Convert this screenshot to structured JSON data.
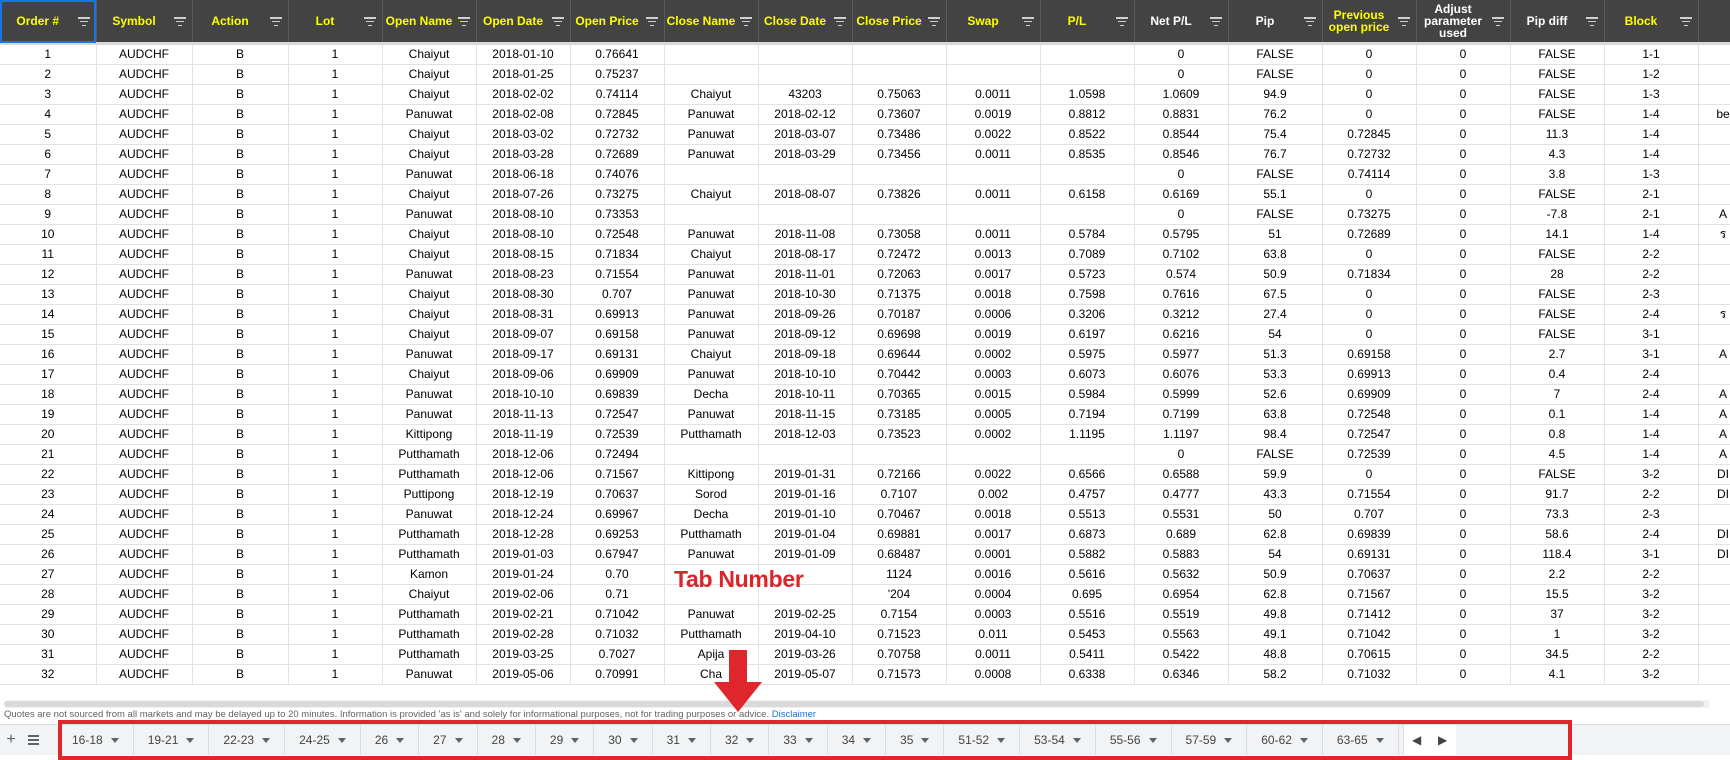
{
  "columns": [
    {
      "label": "Order #",
      "color": "yellow"
    },
    {
      "label": "Symbol",
      "color": "yellow"
    },
    {
      "label": "Action",
      "color": "yellow"
    },
    {
      "label": "Lot",
      "color": "yellow"
    },
    {
      "label": "Open Name",
      "color": "yellow"
    },
    {
      "label": "Open Date",
      "color": "yellow"
    },
    {
      "label": "Open Price",
      "color": "yellow"
    },
    {
      "label": "Close Name",
      "color": "yellow"
    },
    {
      "label": "Close Date",
      "color": "yellow"
    },
    {
      "label": "Close Price",
      "color": "yellow"
    },
    {
      "label": "Swap",
      "color": "yellow"
    },
    {
      "label": "P/L",
      "color": "yellow"
    },
    {
      "label": "Net P/L",
      "color": "white"
    },
    {
      "label": "Pip",
      "color": "white"
    },
    {
      "label": "Previous open price",
      "color": "yellow"
    },
    {
      "label": "Adjust parameter used",
      "color": "white"
    },
    {
      "label": "Pip diff",
      "color": "white"
    },
    {
      "label": "Block",
      "color": "yellow"
    },
    {
      "label": "",
      "color": "white"
    }
  ],
  "rows": [
    [
      "1",
      "AUDCHF",
      "B",
      "1",
      "Chaiyut",
      "2018-01-10",
      "0.76641",
      "",
      "",
      "",
      "",
      "",
      "0",
      "FALSE",
      "0",
      "0",
      "FALSE",
      "1-1",
      ""
    ],
    [
      "2",
      "AUDCHF",
      "B",
      "1",
      "Chaiyut",
      "2018-01-25",
      "0.75237",
      "",
      "",
      "",
      "",
      "",
      "0",
      "FALSE",
      "0",
      "0",
      "FALSE",
      "1-2",
      ""
    ],
    [
      "3",
      "AUDCHF",
      "B",
      "1",
      "Chaiyut",
      "2018-02-02",
      "0.74114",
      "Chaiyut",
      "43203",
      "0.75063",
      "0.0011",
      "1.0598",
      "1.0609",
      "94.9",
      "0",
      "0",
      "FALSE",
      "1-3",
      ""
    ],
    [
      "4",
      "AUDCHF",
      "B",
      "1",
      "Panuwat",
      "2018-02-08",
      "0.72845",
      "Panuwat",
      "2018-02-12",
      "0.73607",
      "0.0019",
      "0.8812",
      "0.8831",
      "76.2",
      "0",
      "0",
      "FALSE",
      "1-4",
      "be"
    ],
    [
      "5",
      "AUDCHF",
      "B",
      "1",
      "Chaiyut",
      "2018-03-02",
      "0.72732",
      "Panuwat",
      "2018-03-07",
      "0.73486",
      "0.0022",
      "0.8522",
      "0.8544",
      "75.4",
      "0.72845",
      "0",
      "11.3",
      "1-4",
      ""
    ],
    [
      "6",
      "AUDCHF",
      "B",
      "1",
      "Chaiyut",
      "2018-03-28",
      "0.72689",
      "Panuwat",
      "2018-03-29",
      "0.73456",
      "0.0011",
      "0.8535",
      "0.8546",
      "76.7",
      "0.72732",
      "0",
      "4.3",
      "1-4",
      ""
    ],
    [
      "7",
      "AUDCHF",
      "B",
      "1",
      "Panuwat",
      "2018-06-18",
      "0.74076",
      "",
      "",
      "",
      "",
      "",
      "0",
      "FALSE",
      "0.74114",
      "0",
      "3.8",
      "1-3",
      ""
    ],
    [
      "8",
      "AUDCHF",
      "B",
      "1",
      "Chaiyut",
      "2018-07-26",
      "0.73275",
      "Chaiyut",
      "2018-08-07",
      "0.73826",
      "0.0011",
      "0.6158",
      "0.6169",
      "55.1",
      "0",
      "0",
      "FALSE",
      "2-1",
      ""
    ],
    [
      "9",
      "AUDCHF",
      "B",
      "1",
      "Panuwat",
      "2018-08-10",
      "0.73353",
      "",
      "",
      "",
      "",
      "",
      "0",
      "FALSE",
      "0.73275",
      "0",
      "-7.8",
      "2-1",
      "A"
    ],
    [
      "10",
      "AUDCHF",
      "B",
      "1",
      "Chaiyut",
      "2018-08-10",
      "0.72548",
      "Panuwat",
      "2018-11-08",
      "0.73058",
      "0.0011",
      "0.5784",
      "0.5795",
      "51",
      "0.72689",
      "0",
      "14.1",
      "1-4",
      "ร"
    ],
    [
      "11",
      "AUDCHF",
      "B",
      "1",
      "Chaiyut",
      "2018-08-15",
      "0.71834",
      "Chaiyut",
      "2018-08-17",
      "0.72472",
      "0.0013",
      "0.7089",
      "0.7102",
      "63.8",
      "0",
      "0",
      "FALSE",
      "2-2",
      ""
    ],
    [
      "12",
      "AUDCHF",
      "B",
      "1",
      "Panuwat",
      "2018-08-23",
      "0.71554",
      "Panuwat",
      "2018-11-01",
      "0.72063",
      "0.0017",
      "0.5723",
      "0.574",
      "50.9",
      "0.71834",
      "0",
      "28",
      "2-2",
      ""
    ],
    [
      "13",
      "AUDCHF",
      "B",
      "1",
      "Chaiyut",
      "2018-08-30",
      "0.707",
      "Panuwat",
      "2018-10-30",
      "0.71375",
      "0.0018",
      "0.7598",
      "0.7616",
      "67.5",
      "0",
      "0",
      "FALSE",
      "2-3",
      ""
    ],
    [
      "14",
      "AUDCHF",
      "B",
      "1",
      "Chaiyut",
      "2018-08-31",
      "0.69913",
      "Panuwat",
      "2018-09-26",
      "0.70187",
      "0.0006",
      "0.3206",
      "0.3212",
      "27.4",
      "0",
      "0",
      "FALSE",
      "2-4",
      "ร"
    ],
    [
      "15",
      "AUDCHF",
      "B",
      "1",
      "Chaiyut",
      "2018-09-07",
      "0.69158",
      "Panuwat",
      "2018-09-12",
      "0.69698",
      "0.0019",
      "0.6197",
      "0.6216",
      "54",
      "0",
      "0",
      "FALSE",
      "3-1",
      ""
    ],
    [
      "16",
      "AUDCHF",
      "B",
      "1",
      "Panuwat",
      "2018-09-17",
      "0.69131",
      "Chaiyut",
      "2018-09-18",
      "0.69644",
      "0.0002",
      "0.5975",
      "0.5977",
      "51.3",
      "0.69158",
      "0",
      "2.7",
      "3-1",
      "A"
    ],
    [
      "17",
      "AUDCHF",
      "B",
      "1",
      "Chaiyut",
      "2018-09-06",
      "0.69909",
      "Panuwat",
      "2018-10-10",
      "0.70442",
      "0.0003",
      "0.6073",
      "0.6076",
      "53.3",
      "0.69913",
      "0",
      "0.4",
      "2-4",
      ""
    ],
    [
      "18",
      "AUDCHF",
      "B",
      "1",
      "Panuwat",
      "2018-10-10",
      "0.69839",
      "Decha",
      "2018-10-11",
      "0.70365",
      "0.0015",
      "0.5984",
      "0.5999",
      "52.6",
      "0.69909",
      "0",
      "7",
      "2-4",
      "A"
    ],
    [
      "19",
      "AUDCHF",
      "B",
      "1",
      "Panuwat",
      "2018-11-13",
      "0.72547",
      "Panuwat",
      "2018-11-15",
      "0.73185",
      "0.0005",
      "0.7194",
      "0.7199",
      "63.8",
      "0.72548",
      "0",
      "0.1",
      "1-4",
      "A"
    ],
    [
      "20",
      "AUDCHF",
      "B",
      "1",
      "Kittipong",
      "2018-11-19",
      "0.72539",
      "Putthamath",
      "2018-12-03",
      "0.73523",
      "0.0002",
      "1.1195",
      "1.1197",
      "98.4",
      "0.72547",
      "0",
      "0.8",
      "1-4",
      "A"
    ],
    [
      "21",
      "AUDCHF",
      "B",
      "1",
      "Putthamath",
      "2018-12-06",
      "0.72494",
      "",
      "",
      "",
      "",
      "",
      "0",
      "FALSE",
      "0.72539",
      "0",
      "4.5",
      "1-4",
      "A"
    ],
    [
      "22",
      "AUDCHF",
      "B",
      "1",
      "Putthamath",
      "2018-12-06",
      "0.71567",
      "Kittipong",
      "2019-01-31",
      "0.72166",
      "0.0022",
      "0.6566",
      "0.6588",
      "59.9",
      "0",
      "0",
      "FALSE",
      "3-2",
      "DI"
    ],
    [
      "23",
      "AUDCHF",
      "B",
      "1",
      "Puttipong",
      "2018-12-19",
      "0.70637",
      "Sorod",
      "2019-01-16",
      "0.7107",
      "0.002",
      "0.4757",
      "0.4777",
      "43.3",
      "0.71554",
      "0",
      "91.7",
      "2-2",
      "DI"
    ],
    [
      "24",
      "AUDCHF",
      "B",
      "1",
      "Panuwat",
      "2018-12-24",
      "0.69967",
      "Decha",
      "2019-01-10",
      "0.70467",
      "0.0018",
      "0.5513",
      "0.5531",
      "50",
      "0.707",
      "0",
      "73.3",
      "2-3",
      ""
    ],
    [
      "25",
      "AUDCHF",
      "B",
      "1",
      "Putthamath",
      "2018-12-28",
      "0.69253",
      "Putthamath",
      "2019-01-04",
      "0.69881",
      "0.0017",
      "0.6873",
      "0.689",
      "62.8",
      "0.69839",
      "0",
      "58.6",
      "2-4",
      "DI"
    ],
    [
      "26",
      "AUDCHF",
      "B",
      "1",
      "Putthamath",
      "2019-01-03",
      "0.67947",
      "Panuwat",
      "2019-01-09",
      "0.68487",
      "0.0001",
      "0.5882",
      "0.5883",
      "54",
      "0.69131",
      "0",
      "118.4",
      "3-1",
      "DI"
    ],
    [
      "27",
      "AUDCHF",
      "B",
      "1",
      "Kamon",
      "2019-01-24",
      "0.70",
      "",
      "",
      "1124",
      "0.0016",
      "0.5616",
      "0.5632",
      "50.9",
      "0.70637",
      "0",
      "2.2",
      "2-2",
      ""
    ],
    [
      "28",
      "AUDCHF",
      "B",
      "1",
      "Chaiyut",
      "2019-02-06",
      "0.71",
      "",
      "",
      "'204",
      "0.0004",
      "0.695",
      "0.6954",
      "62.8",
      "0.71567",
      "0",
      "15.5",
      "3-2",
      ""
    ],
    [
      "29",
      "AUDCHF",
      "B",
      "1",
      "Putthamath",
      "2019-02-21",
      "0.71042",
      "Panuwat",
      "2019-02-25",
      "0.7154",
      "0.0003",
      "0.5516",
      "0.5519",
      "49.8",
      "0.71412",
      "0",
      "37",
      "3-2",
      ""
    ],
    [
      "30",
      "AUDCHF",
      "B",
      "1",
      "Putthamath",
      "2019-02-28",
      "0.71032",
      "Putthamath",
      "2019-04-10",
      "0.71523",
      "0.011",
      "0.5453",
      "0.5563",
      "49.1",
      "0.71042",
      "0",
      "1",
      "3-2",
      ""
    ],
    [
      "31",
      "AUDCHF",
      "B",
      "1",
      "Putthamath",
      "2019-03-25",
      "0.7027",
      "Apija",
      "2019-03-26",
      "0.70758",
      "0.0011",
      "0.5411",
      "0.5422",
      "48.8",
      "0.70615",
      "0",
      "34.5",
      "2-2",
      ""
    ],
    [
      "32",
      "AUDCHF",
      "B",
      "1",
      "Panuwat",
      "2019-05-06",
      "0.70991",
      "Cha",
      "2019-05-07",
      "0.71573",
      "0.0008",
      "0.6338",
      "0.6346",
      "58.2",
      "0.71032",
      "0",
      "4.1",
      "3-2",
      ""
    ]
  ],
  "disclaimer": {
    "text": "Quotes are not sourced from all markets and may be delayed up to 20 minutes. Information is provided 'as is' and solely for informational purposes, not for trading purposes or advice.",
    "link": "Disclaimer"
  },
  "tabs": [
    "16-18",
    "19-21",
    "22-23",
    "24-25",
    "26",
    "27",
    "28",
    "29",
    "30",
    "31",
    "32",
    "33",
    "34",
    "35",
    "51-52",
    "53-54",
    "55-56",
    "57-59",
    "60-62",
    "63-65"
  ],
  "tab_controls": {
    "add": "+",
    "prev": "◀",
    "next": "▶"
  },
  "annotation": {
    "label": "Tab Number",
    "color": "#d9262d"
  }
}
